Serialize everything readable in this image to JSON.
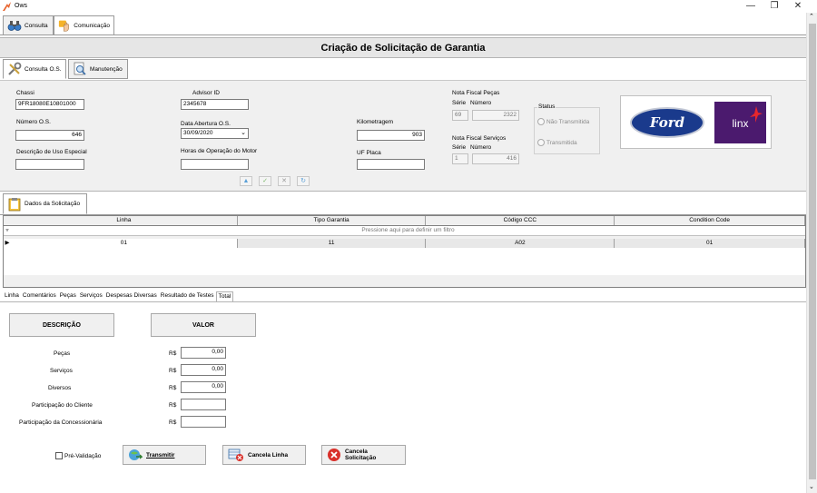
{
  "window": {
    "title": "Ows",
    "minimize": "—",
    "maximize": "❐",
    "close": "✕"
  },
  "main_tabs": [
    {
      "label": "Consulta"
    },
    {
      "label": "Comunicação"
    }
  ],
  "header": {
    "title": "Criação de Solicitação de Garantia"
  },
  "sub_tabs": [
    {
      "label": "Consulta O.S."
    },
    {
      "label": "Manutenção"
    }
  ],
  "form": {
    "chassi": {
      "label": "Chassi",
      "value": "9FR18080E10801000"
    },
    "advisor": {
      "label": "Advisor ID",
      "value": "2345678"
    },
    "numero_os": {
      "label": "Número O.S.",
      "value": "646"
    },
    "data_abertura": {
      "label": "Data Abertura O.S.",
      "value": "30/09/2020"
    },
    "kilometragem": {
      "label": "Kilometragem",
      "value": "903"
    },
    "descricao_uso": {
      "label": "Descrição de Uso Especial",
      "value": ""
    },
    "horas_operacao": {
      "label": "Horas de Operação do Motor",
      "value": ""
    },
    "uf_placa": {
      "label": "UF Placa",
      "value": ""
    },
    "nf_pecas": {
      "label": "Nota Fiscal Peças",
      "serie_label": "Série",
      "numero_label": "Número",
      "serie": "69",
      "numero": "2322"
    },
    "nf_servicos": {
      "label": "Nota Fiscal Serviços",
      "serie_label": "Série",
      "numero_label": "Número",
      "serie": "1",
      "numero": "416"
    },
    "status": {
      "label": "Status",
      "options": [
        "Não Transmitida",
        "Transmitida"
      ]
    },
    "nav": {
      "up": "▲",
      "ok": "✓",
      "cancel": "✕",
      "refresh": "↻"
    }
  },
  "logos": {
    "ford": "Ford",
    "linx": "linx"
  },
  "dados_tab": {
    "label": "Dados da Solicitação"
  },
  "grid": {
    "columns": [
      "Linha",
      "Tipo Garantia",
      "Código CCC",
      "Condition Code"
    ],
    "filter_text": "Pressione aqui para definir um filtro",
    "rows": [
      [
        "01",
        "11",
        "A02",
        "01"
      ]
    ]
  },
  "bottom_tabs": [
    "Linha",
    "Comentários",
    "Peças",
    "Serviços",
    "Despesas Diversas",
    "Resultado de Testes",
    "Total"
  ],
  "totals": {
    "col_descricao": "DESCRIÇÃO",
    "col_valor": "VALOR",
    "currency": "R$",
    "rows": [
      {
        "label": "Peças",
        "value": "0,00"
      },
      {
        "label": "Serviços",
        "value": "0,00"
      },
      {
        "label": "Diversos",
        "value": "0,00"
      },
      {
        "label": "Participação do Cliente",
        "value": ""
      },
      {
        "label": "Participação da Concessionária",
        "value": ""
      }
    ]
  },
  "actions": {
    "pre_validacao": "Pré-Validação",
    "transmitir": "Transmitir",
    "cancela_linha": "Cancela Linha",
    "cancela_solicitacao": "Cancela Solicitação"
  },
  "colors": {
    "ford_blue": "#1a3a8c",
    "linx_purple": "#4b1a6e",
    "linx_red": "#e8262c",
    "cancel_red": "#d9302a"
  }
}
